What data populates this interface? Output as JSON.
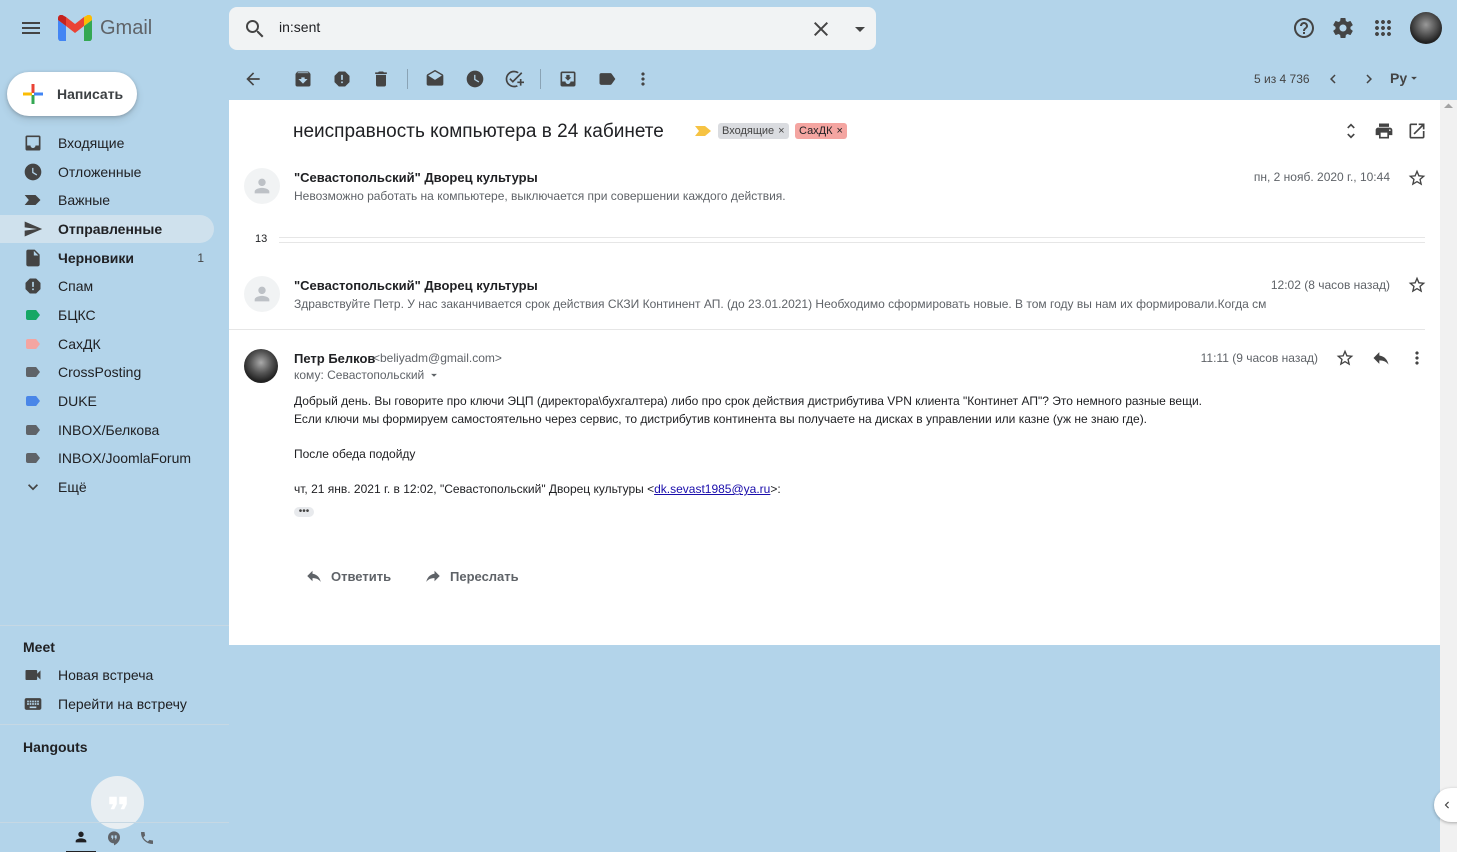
{
  "app": {
    "name": "Gmail"
  },
  "search": {
    "query": "in:sent"
  },
  "compose": {
    "label": "Написать"
  },
  "sidebar": {
    "items": [
      {
        "label": "Входящие",
        "icon": "inbox-icon"
      },
      {
        "label": "Отложенные",
        "icon": "clock-icon"
      },
      {
        "label": "Важные",
        "icon": "important-icon"
      },
      {
        "label": "Отправленные",
        "icon": "send-icon",
        "active": true
      },
      {
        "label": "Черновики",
        "icon": "draft-icon",
        "count": "1"
      },
      {
        "label": "Спам",
        "icon": "spam-icon"
      },
      {
        "label": "БЦКС",
        "icon": "label-icon",
        "color": "#16a765"
      },
      {
        "label": "СахДК",
        "icon": "label-icon",
        "color": "#f4a5a1"
      },
      {
        "label": "CrossPosting",
        "icon": "label-icon",
        "color": "#5f6368"
      },
      {
        "label": "DUKE",
        "icon": "label-icon",
        "color": "#4a86e8"
      },
      {
        "label": "INBOX/Белкова",
        "icon": "label-icon",
        "color": "#5f6368"
      },
      {
        "label": "INBOX/JoomlaForum",
        "icon": "label-icon",
        "color": "#5f6368"
      },
      {
        "label": "Ещё",
        "icon": "chevron-down-icon"
      }
    ]
  },
  "meet": {
    "title": "Meet",
    "new_meeting": "Новая встреча",
    "join_meeting": "Перейти на встречу"
  },
  "hangouts": {
    "title": "Hangouts"
  },
  "toolbar": {
    "pagination": "5 из 4 736",
    "input_tool": "Ру"
  },
  "thread": {
    "subject": "неисправность компьютера в 24 кабинете",
    "labels": [
      {
        "name": "Входящие",
        "color": "#dadce0"
      },
      {
        "name": "СахДК",
        "color": "#f4a5a1"
      }
    ],
    "messages": [
      {
        "sender": "\"Севастопольский\" Дворец культуры",
        "snippet": "Невозможно работать на компьютере, выключается при совершении каждого действия.",
        "date": "пн, 2 нояб. 2020 г., 10:44"
      },
      {
        "sender": "\"Севастопольский\" Дворец культуры",
        "snippet": "Здравствуйте Петр. У нас заканчивается срок действия СКЗИ Континент АП. (до 23.01.2021) Необходимо сформировать новые. В том году вы нам их формировали.Когда см",
        "date": "12:02 (8 часов назад)"
      }
    ],
    "collapsed_count": "13",
    "expanded": {
      "sender": "Петр Белков",
      "email": "<beliyadm@gmail.com>",
      "to": "кому: Севастопольский",
      "date": "11:11 (9 часов назад)",
      "body": [
        "Добрый день. Вы говорите про ключи ЭЦП (директора\\бухгалтера) либо про срок действия дистрибутива VPN клиента \"Континет АП\"? Это немного разные вещи.",
        "Если ключи мы формируем самостоятельно через сервис, то дистрибутив континента вы получаете на дисках в управлении или казне (уж не знаю где).",
        "После обеда подойду"
      ],
      "quote_prefix": "чт, 21 янв. 2021 г. в 12:02, \"Севастопольский\" Дворец культуры <",
      "quote_email": "dk.sevast1985@ya.ru",
      "quote_suffix": ">:",
      "ellipsis": "•••"
    },
    "reply_label": "Ответить",
    "forward_label": "Переслать"
  }
}
